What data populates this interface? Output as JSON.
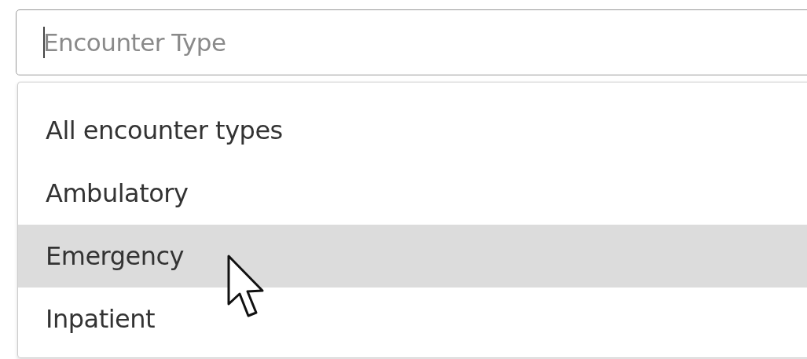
{
  "field": {
    "placeholder": "Encounter Type",
    "focused": true
  },
  "options": [
    {
      "label": "All encounter types",
      "highlighted": false
    },
    {
      "label": "Ambulatory",
      "highlighted": false
    },
    {
      "label": "Emergency",
      "highlighted": true
    },
    {
      "label": "Inpatient",
      "highlighted": false
    }
  ]
}
